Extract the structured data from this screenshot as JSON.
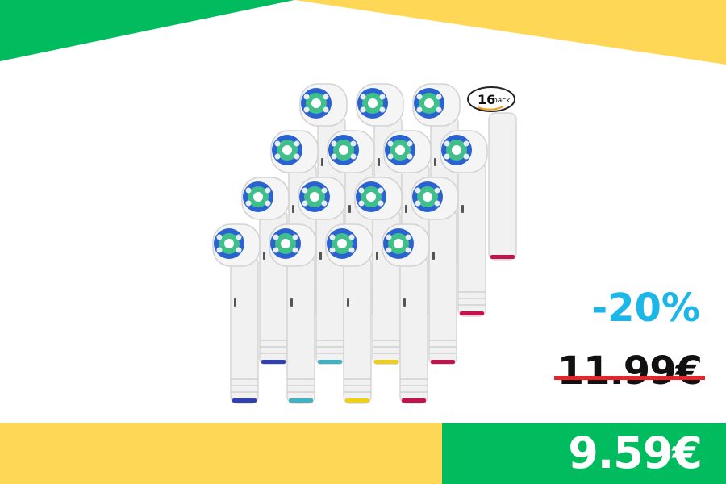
{
  "offer": {
    "discount": "-20%",
    "old_price": "11.99€",
    "new_price": "9.59€"
  },
  "product": {
    "badge_number": "16",
    "badge_word": "pack",
    "icon": "toothbrush-heads-image"
  },
  "colors": {
    "green": "#00bc5e",
    "yellow": "#fed757",
    "discount_blue": "#1cb6e9",
    "strike_red": "#e8242a"
  }
}
